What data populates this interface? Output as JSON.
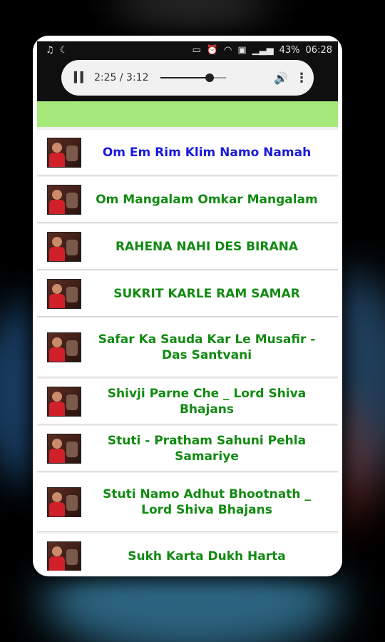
{
  "status_bar": {
    "left_icons": [
      "music-note-icon",
      "moon-icon"
    ],
    "right_icons": [
      "cast-icon",
      "alarm-icon",
      "wifi-icon",
      "sim-icon",
      "signal-icon"
    ],
    "battery": "43%",
    "time": "06:28"
  },
  "player": {
    "time": "2:25 / 3:12",
    "progress_fraction": 0.75,
    "pause_icon": "pause-icon",
    "volume_icon": "volume-icon",
    "more_icon": "more-vert-icon"
  },
  "colors": {
    "green_bar": "#a6e87a",
    "title_green": "#118a11",
    "title_active": "#1a1adc"
  },
  "songs": [
    {
      "title": "Om Em Rim Klim Namo Namah",
      "active": true
    },
    {
      "title": "Om Mangalam Omkar Mangalam"
    },
    {
      "title": "RAHENA NAHI DES BIRANA"
    },
    {
      "title": "SUKRIT KARLE RAM SAMAR"
    },
    {
      "title": "Safar Ka Sauda Kar Le Musafir - Das Santvani"
    },
    {
      "title": "Shivji Parne Che _ Lord Shiva Bhajans"
    },
    {
      "title": "Stuti - Pratham Sahuni Pehla Samariye"
    },
    {
      "title": "Stuti Namo Adhut Bhootnath _ Lord Shiva Bhajans"
    },
    {
      "title": "Sukh Karta Dukh Harta"
    }
  ]
}
